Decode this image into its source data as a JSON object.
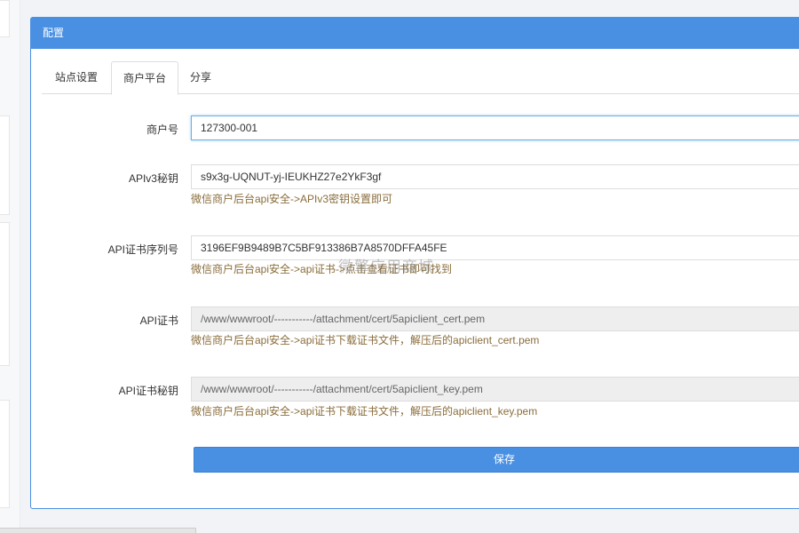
{
  "panel": {
    "title": "配置"
  },
  "tabs": [
    {
      "label": "站点设置",
      "active": false
    },
    {
      "label": "商户平台",
      "active": true
    },
    {
      "label": "分享",
      "active": false
    }
  ],
  "form": {
    "merchant_id": {
      "label": "商户号",
      "value": "127300-001"
    },
    "apiv3_key": {
      "label": "APIv3秘钥",
      "value": "s9x3g-UQNUT-yj-IEUKHZ27e2YkF3gf",
      "help": "微信商户后台api安全->APIv3密钥设置即可"
    },
    "cert_serial": {
      "label": "API证书序列号",
      "value": "3196EF9B9489B7C5BF913386B7A8570DFFA45FE",
      "help": "微信商户后台api安全->api证书->点击查看证书即可找到"
    },
    "api_cert": {
      "label": "API证书",
      "value": "/www/wwwroot/-----------/attachment/cert/5apiclient_cert.pem",
      "help": "微信商户后台api安全->api证书下载证书文件，解压后的apiclient_cert.pem"
    },
    "api_cert_key": {
      "label": "API证书秘钥",
      "value": "/www/wwwroot/-----------/attachment/cert/5apiclient_key.pem",
      "help": "微信商户后台api安全->api证书下载证书文件，解压后的apiclient_key.pem"
    }
  },
  "watermark": "微擎应用商城",
  "save_label": "保存",
  "colors": {
    "primary": "#4a90e2",
    "help_text": "#8a6d3b"
  }
}
